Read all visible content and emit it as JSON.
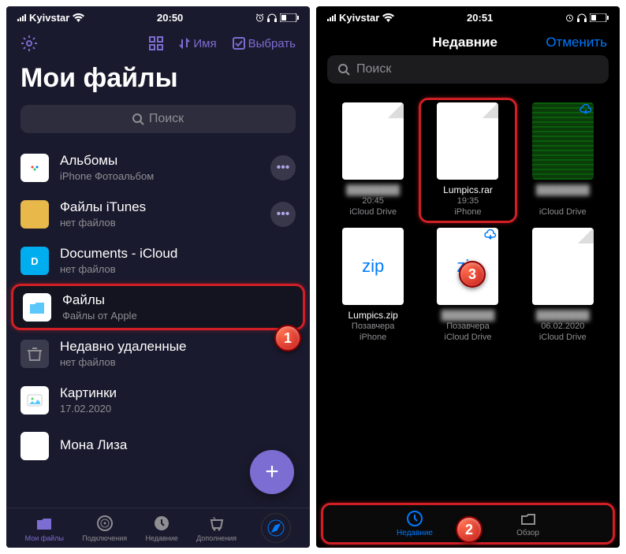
{
  "left": {
    "status": {
      "carrier": "Kyivstar",
      "time": "20:50"
    },
    "toolbar": {
      "sort_label": "Имя",
      "select_label": "Выбрать"
    },
    "title": "Мои файлы",
    "search_placeholder": "Поиск",
    "files": [
      {
        "name": "Альбомы",
        "sub": "iPhone Фотоальбом",
        "iconBg": "#fff",
        "more": true
      },
      {
        "name": "Файлы iTunes",
        "sub": "нет файлов",
        "iconBg": "#e8b84a",
        "more": true
      },
      {
        "name": "Documents - iCloud",
        "sub": "нет файлов",
        "iconBg": "#00aeef",
        "more": false
      },
      {
        "name": "Файлы",
        "sub": "Файлы от Apple",
        "iconBg": "#fff",
        "more": false,
        "highlight": true
      },
      {
        "name": "Недавно удаленные",
        "sub": "нет файлов",
        "iconBg": "#3b3b4e",
        "more": false
      },
      {
        "name": "Картинки",
        "sub": "17.02.2020",
        "iconBg": "#fff",
        "more": false
      },
      {
        "name": "Мона Лиза",
        "sub": "",
        "iconBg": "#fff",
        "more": false
      }
    ],
    "tabs": [
      {
        "label": "Мои файлы",
        "active": true
      },
      {
        "label": "Подключения",
        "active": false
      },
      {
        "label": "Недавние",
        "active": false
      },
      {
        "label": "Дополнения",
        "active": false
      }
    ]
  },
  "right": {
    "status": {
      "carrier": "Kyivstar",
      "time": "20:51"
    },
    "header": {
      "title": "Недавние",
      "cancel": "Отменить"
    },
    "search_placeholder": "Поиск",
    "grid": [
      {
        "name": "",
        "meta1": "20:45",
        "meta2": "iCloud Drive",
        "type": "doc",
        "blurred": true
      },
      {
        "name": "Lumpics.rar",
        "meta1": "19:35",
        "meta2": "iPhone",
        "type": "doc",
        "highlight": true
      },
      {
        "name": "",
        "meta1": "",
        "meta2": "iCloud Drive",
        "type": "green",
        "cloud": true,
        "blurred": true
      },
      {
        "name": "Lumpics.zip",
        "meta1": "Позавчера",
        "meta2": "iPhone",
        "type": "zip"
      },
      {
        "name": "",
        "meta1": "Позавчера",
        "meta2": "iCloud Drive",
        "type": "zip",
        "cloud": true,
        "blurred": true
      },
      {
        "name": "",
        "meta1": "06.02.2020",
        "meta2": "iCloud Drive",
        "type": "doc",
        "blurred": true
      }
    ],
    "tabs": [
      {
        "label": "Недавние",
        "active": true
      },
      {
        "label": "Обзор",
        "active": false
      }
    ]
  },
  "callouts": {
    "c1": "1",
    "c2": "2",
    "c3": "3"
  }
}
